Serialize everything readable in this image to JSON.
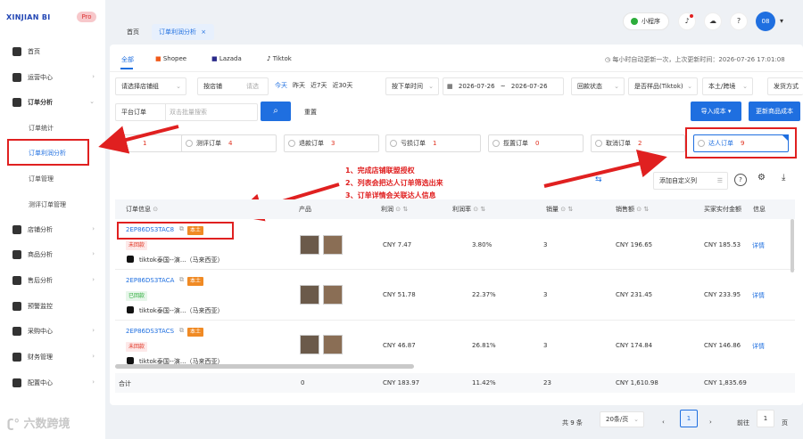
{
  "brand": {
    "logo": "XINJIAN BI",
    "badge": "Pro"
  },
  "sidebar": {
    "items": [
      {
        "label": "首页"
      },
      {
        "label": "运营中心"
      },
      {
        "label": "订单分析"
      },
      {
        "label": "店铺分析"
      },
      {
        "label": "商品分析"
      },
      {
        "label": "售后分析"
      },
      {
        "label": "预警监控"
      },
      {
        "label": "采购中心"
      },
      {
        "label": "财务管理"
      },
      {
        "label": "配置中心"
      }
    ],
    "order_sub": [
      "订单统计",
      "订单利润分析",
      "订单管理",
      "测评订单管理"
    ]
  },
  "top_tabs": {
    "home": "首页",
    "current": "订单利润分析",
    "close": "×"
  },
  "header": {
    "mini_program": "小程序",
    "avatar": "08",
    "caret": "▾"
  },
  "platform_tabs": [
    "全部",
    "Shopee",
    "Lazada",
    "Tiktok"
  ],
  "update_info": "每小时自动更新一次，上次更新时间：2026-07-26 17:01:08",
  "filters": {
    "store_placeholder": "请选择店铺组",
    "by_store": "按店铺",
    "store_select": "请选",
    "quick_dates": [
      "今天",
      "昨天",
      "近7天",
      "近30天"
    ],
    "order_time": "按下单时间",
    "date_start": "2026-07-26",
    "date_sep": "~",
    "date_end": "2026-07-26",
    "refund_status": "回款状态",
    "sample": "是否样品(Tiktok)",
    "local_cross": "本土/跨境",
    "shipping": "发货方式",
    "platform_order": "平台订单",
    "batch_search_placeholder": "双击批量搜索",
    "reset": "重置",
    "import_cost": "导入成本",
    "update_cost": "更新商品成本"
  },
  "order_cards": [
    {
      "label": "",
      "count": "1"
    },
    {
      "label": "测评订单",
      "count": "4"
    },
    {
      "label": "退款订单",
      "count": "3"
    },
    {
      "label": "亏损订单",
      "count": "1"
    },
    {
      "label": "揽置订单",
      "count": "0"
    },
    {
      "label": "取消订单",
      "count": "2"
    },
    {
      "label": "达人订单",
      "count": "9"
    }
  ],
  "annotation": {
    "line1": "1、完成店铺联盟授权",
    "line2": "2、列表会把达人订单筛选出来",
    "line3": "3、订单详情会关联达人信息"
  },
  "table_tools": {
    "custom_col": "添加自定义列"
  },
  "table": {
    "columns": [
      "订单信息",
      "产品",
      "利润",
      "利润率",
      "销量",
      "销售额",
      "买家实付金额",
      "信息"
    ],
    "rows": [
      {
        "order_id": "2EP86DS3TAC8",
        "tag": "本土",
        "status": "未回款",
        "status_type": "red",
        "shop": "tiktok泰国--演...（马来西亚）",
        "profit": "CNY 7.47",
        "margin": "3.80%",
        "qty": "3",
        "sales": "CNY 196.65",
        "paid": "CNY 185.53",
        "detail": "详情"
      },
      {
        "order_id": "2EP86DS3TACA",
        "tag": "本土",
        "status": "已回款",
        "status_type": "green",
        "shop": "tiktok泰国--演...（马来西亚）",
        "profit": "CNY 51.78",
        "margin": "22.37%",
        "qty": "3",
        "sales": "CNY 231.45",
        "paid": "CNY 233.95",
        "detail": "详情"
      },
      {
        "order_id": "2EP86DS3TACS",
        "tag": "本土",
        "status": "未回款",
        "status_type": "red",
        "shop": "tiktok泰国--演...（马来西亚）",
        "profit": "CNY 46.87",
        "margin": "26.81%",
        "qty": "3",
        "sales": "CNY 174.84",
        "paid": "CNY 146.86",
        "detail": "详情"
      }
    ],
    "total": {
      "label": "合计",
      "products": "0",
      "profit": "CNY 183.97",
      "margin": "11.42%",
      "qty": "23",
      "sales": "CNY 1,610.98",
      "paid": "CNY 1,835.69"
    }
  },
  "pagination": {
    "total": "共 9 条",
    "per_page": "20条/页",
    "prev": "‹",
    "page": "1",
    "next": "›",
    "goto": "前往",
    "goto_page": "1",
    "page_unit": "页"
  },
  "watermark": "六数跨境",
  "colors": {
    "primary": "#1f6fe0",
    "annotation": "#e02020",
    "count": "#e0301e"
  }
}
